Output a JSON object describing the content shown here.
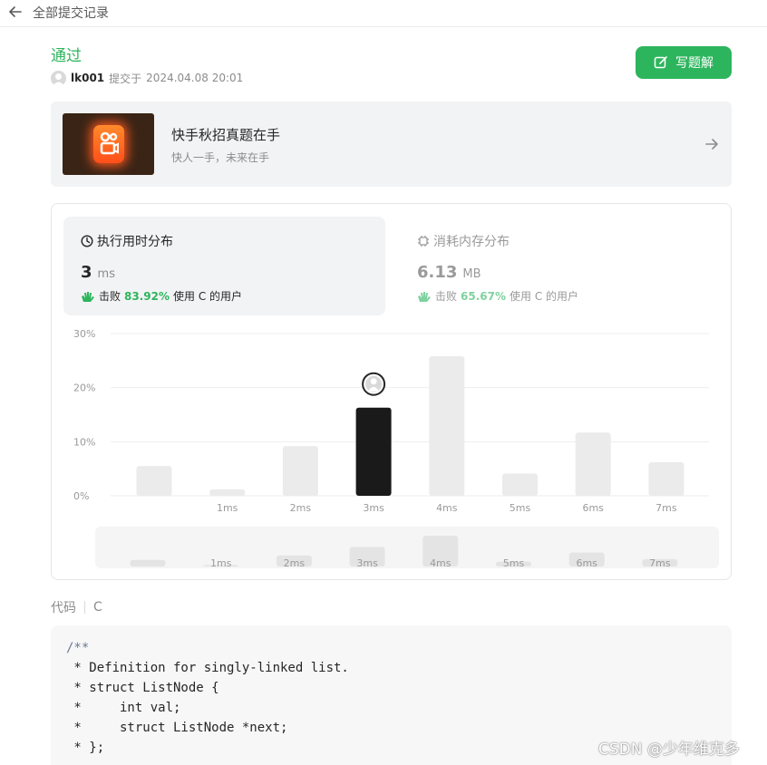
{
  "topbar": {
    "back_icon": "arrow-left-icon",
    "title": "全部提交记录"
  },
  "submission": {
    "status": "通过",
    "user": "lk001",
    "submitted_label": "提交于",
    "time": "2024.04.08 20:01"
  },
  "solution_button": {
    "label": "写题解",
    "icon": "edit-icon"
  },
  "banner": {
    "title": "快手秋招真题在手",
    "subtitle": "快人一手，未来在手",
    "icon": "arrow-right-icon"
  },
  "runtime": {
    "label": "执行用时分布",
    "value": "3",
    "unit": "ms",
    "beat_prefix": "击败",
    "beat_pct": "83.92%",
    "beat_suffix": "使用 C 的用户",
    "icon": "clock-icon"
  },
  "memory": {
    "label": "消耗内存分布",
    "value": "6.13",
    "unit": "MB",
    "beat_prefix": "击败",
    "beat_pct": "65.67%",
    "beat_suffix": "使用 C 的用户",
    "icon": "chip-icon"
  },
  "chart_data": {
    "type": "bar",
    "categories": [
      "",
      "1ms",
      "2ms",
      "3ms",
      "4ms",
      "5ms",
      "6ms",
      "7ms"
    ],
    "values": [
      5.5,
      1.2,
      9.2,
      16.3,
      25.8,
      4.1,
      11.7,
      6.2
    ],
    "highlight_index": 3,
    "y_ticks": [
      "0%",
      "10%",
      "20%",
      "30%"
    ],
    "ylim": [
      0,
      30
    ],
    "colors": {
      "bar": "#ebebeb",
      "highlight": "#1a1a1a"
    }
  },
  "code": {
    "label": "代码",
    "language": "C",
    "lines": [
      "/**",
      " * Definition for singly-linked list.",
      " * struct ListNode {",
      " *     int val;",
      " *     struct ListNode *next;",
      " * };"
    ]
  },
  "watermark": "CSDN @少年维克多"
}
